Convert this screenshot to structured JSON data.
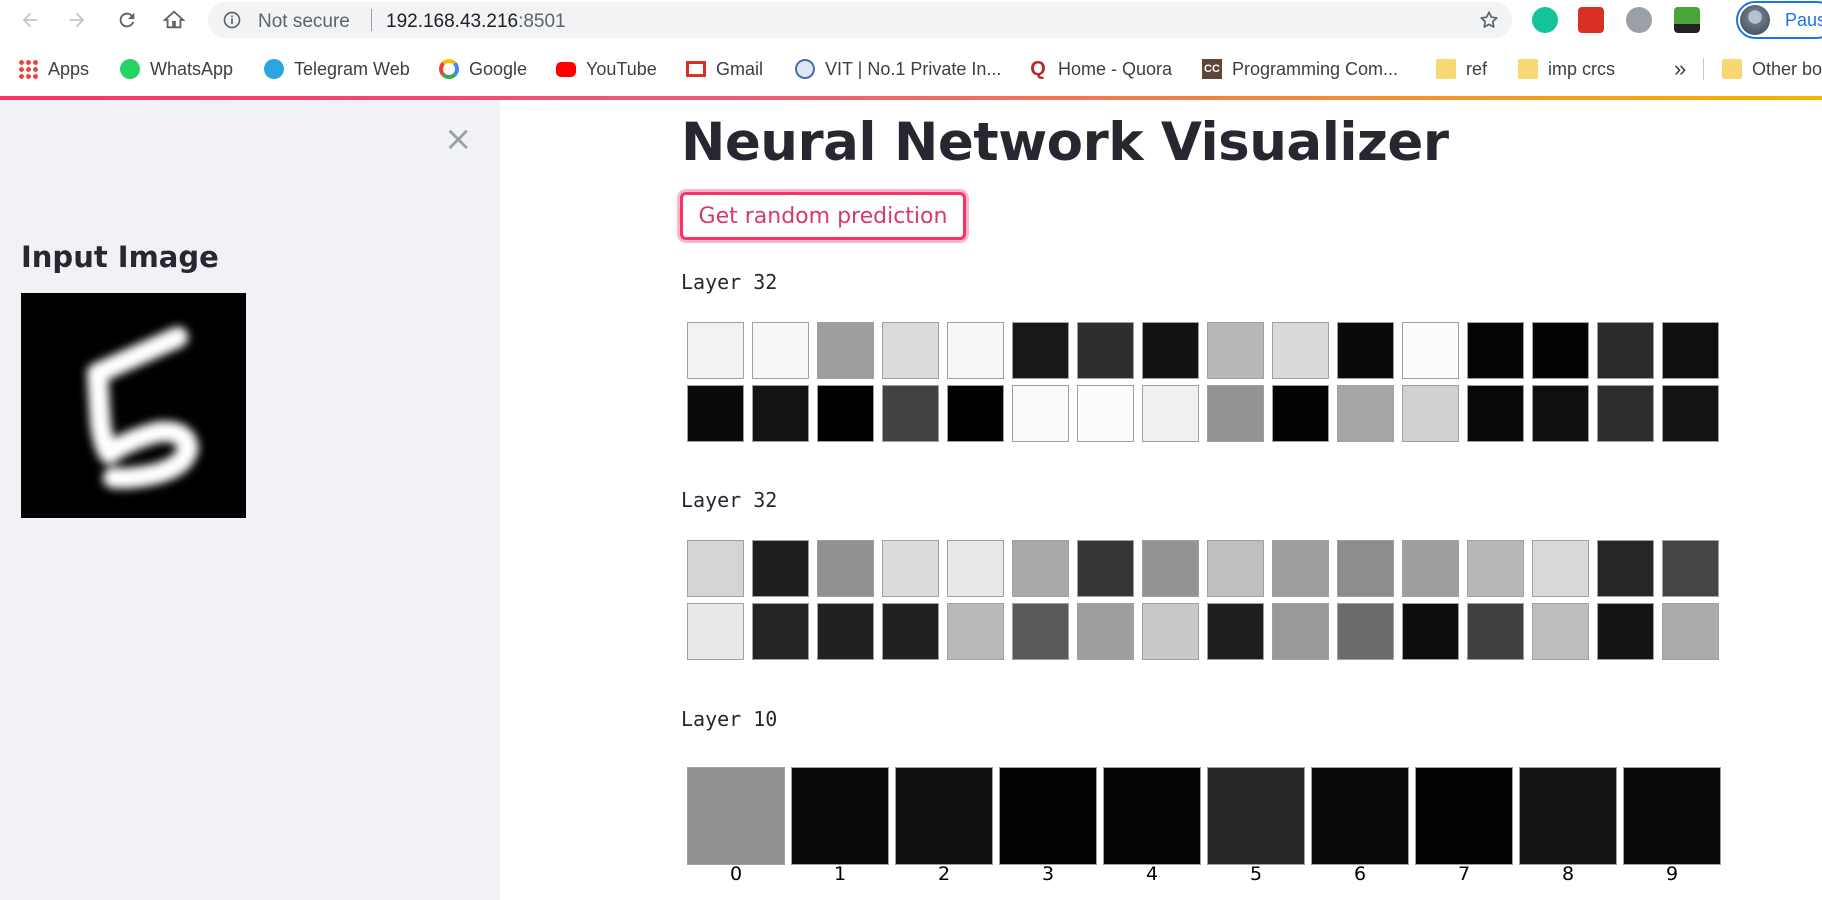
{
  "browser": {
    "security_label": "Not secure",
    "url_host": "192.168.43.216",
    "url_port": ":8501",
    "profile_name": "Paus"
  },
  "bookmarks": [
    {
      "label": "Apps",
      "icon": "apps-grid-icon"
    },
    {
      "label": "WhatsApp",
      "icon": "whatsapp-icon"
    },
    {
      "label": "Telegram Web",
      "icon": "telegram-icon"
    },
    {
      "label": "Google",
      "icon": "google-icon"
    },
    {
      "label": "YouTube",
      "icon": "youtube-icon"
    },
    {
      "label": "Gmail",
      "icon": "gmail-icon"
    },
    {
      "label": "VIT | No.1 Private In...",
      "icon": "vit-icon"
    },
    {
      "label": "Home - Quora",
      "icon": "quora-icon"
    },
    {
      "label": "Programming Com...",
      "icon": "codechef-icon"
    },
    {
      "label": "ref",
      "icon": "folder-icon"
    },
    {
      "label": "imp crcs",
      "icon": "folder-icon"
    },
    {
      "label": "Other bo",
      "icon": "folder-icon"
    }
  ],
  "sidebar": {
    "close_glyph": "×",
    "title": "Input Image",
    "image_digit": "5"
  },
  "main": {
    "title": "Neural Network Visualizer",
    "button_label": "Get random prediction",
    "layers": [
      {
        "label": "Layer 32",
        "values": [
          0.95,
          0.97,
          0.62,
          0.86,
          0.97,
          0.09,
          0.18,
          0.07,
          0.72,
          0.85,
          0.04,
          0.99,
          0.02,
          0.01,
          0.17,
          0.06,
          0.04,
          0.08,
          0.0,
          0.26,
          0.0,
          0.98,
          0.99,
          0.94,
          0.58,
          0.01,
          0.65,
          0.82,
          0.03,
          0.06,
          0.18,
          0.08
        ]
      },
      {
        "label": "Layer 32",
        "values": [
          0.83,
          0.12,
          0.57,
          0.86,
          0.91,
          0.66,
          0.21,
          0.58,
          0.75,
          0.62,
          0.55,
          0.62,
          0.72,
          0.85,
          0.15,
          0.27,
          0.91,
          0.14,
          0.13,
          0.13,
          0.73,
          0.35,
          0.62,
          0.79,
          0.12,
          0.6,
          0.42,
          0.05,
          0.25,
          0.74,
          0.08,
          0.67
        ]
      },
      {
        "label": "Layer 10",
        "values": [
          0.57,
          0.04,
          0.06,
          0.01,
          0.02,
          0.15,
          0.03,
          0.01,
          0.08,
          0.03
        ],
        "class_labels": [
          "0",
          "1",
          "2",
          "3",
          "4",
          "5",
          "6",
          "7",
          "8",
          "9"
        ]
      }
    ]
  }
}
